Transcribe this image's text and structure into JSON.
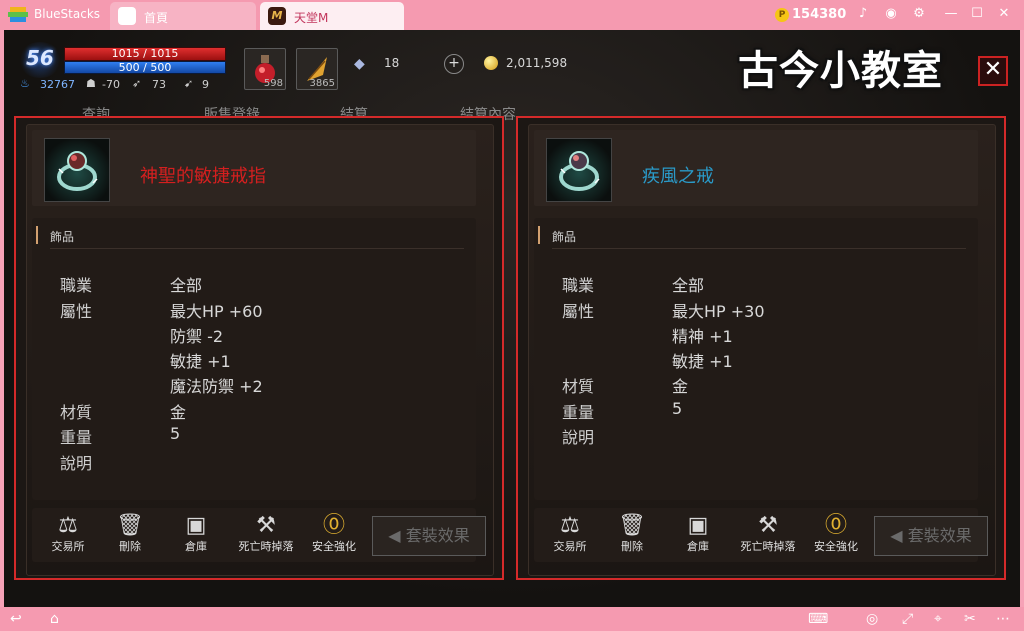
{
  "app": {
    "name": "BlueStacks",
    "tabs": [
      {
        "label": "首頁"
      },
      {
        "label": "天堂M"
      }
    ],
    "coins": "154380",
    "game_tab_icon_text": "M"
  },
  "hud": {
    "level": "56",
    "hp": "1015 / 1015",
    "mp": "500 / 500",
    "stats": [
      "32767",
      "-70",
      "73",
      "9"
    ],
    "potion_counts": [
      "598",
      "3865"
    ],
    "diamonds": "18",
    "gold": "2,011,598",
    "bg_tabs": [
      "查詢",
      "販售登錄",
      "結算",
      "結算內容"
    ]
  },
  "watermark": "古今小教室",
  "colors": {
    "panel_border": "#d42a2a",
    "left_item_name": "#d51f1f",
    "right_item_name": "#2a9ac8"
  },
  "panels": [
    {
      "item_name": "神聖的敏捷戒指",
      "section_title": "飾品",
      "attributes": [
        {
          "label": "職業",
          "values": [
            "全部"
          ]
        },
        {
          "label": "屬性",
          "values": [
            "最大HP +60",
            "防禦 -2",
            "敏捷 +1",
            "魔法防禦 +2"
          ]
        },
        {
          "label": "材質",
          "values": [
            "金"
          ]
        },
        {
          "label": "重量",
          "values": [
            "5"
          ]
        },
        {
          "label": "說明",
          "values": []
        }
      ],
      "buttons": [
        "交易所",
        "刪除",
        "倉庫",
        "死亡時掉落",
        "安全強化"
      ],
      "set_button": "套裝效果"
    },
    {
      "item_name": "疾風之戒",
      "section_title": "飾品",
      "attributes": [
        {
          "label": "職業",
          "values": [
            "全部"
          ]
        },
        {
          "label": "屬性",
          "values": [
            "最大HP +30",
            "精神 +1",
            "敏捷 +1"
          ]
        },
        {
          "label": "材質",
          "values": [
            "金"
          ]
        },
        {
          "label": "重量",
          "values": [
            "5"
          ]
        },
        {
          "label": "說明",
          "values": []
        }
      ],
      "buttons": [
        "交易所",
        "刪除",
        "倉庫",
        "死亡時掉落",
        "安全強化"
      ],
      "set_button": "套裝效果"
    }
  ],
  "icons": {
    "bottom_buttons": [
      "scale-icon",
      "trash-icon",
      "chest-icon",
      "anvil-icon",
      "enchant-shield-icon"
    ]
  }
}
